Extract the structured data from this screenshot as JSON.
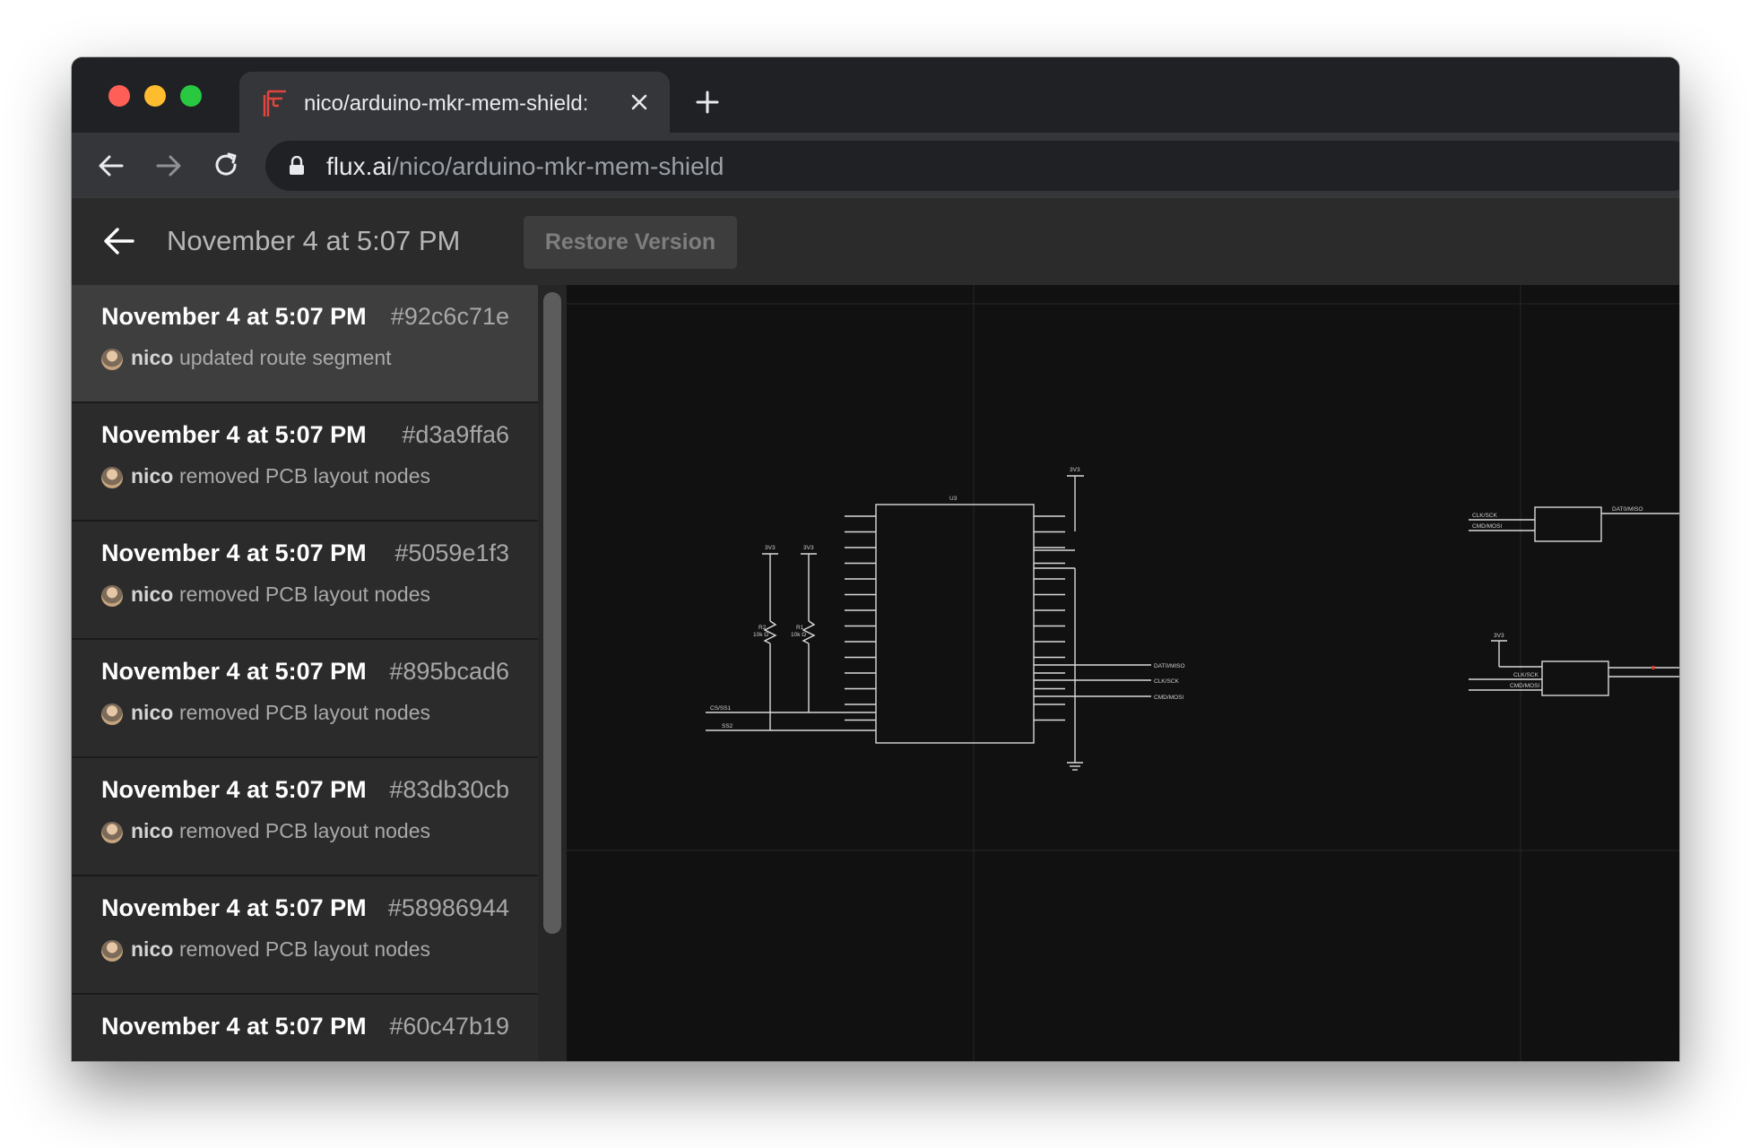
{
  "browser": {
    "tab": {
      "title": "nico/arduino-mkr-mem-shield:"
    },
    "url": {
      "host": "flux.ai",
      "path": "/nico/arduino-mkr-mem-shield"
    }
  },
  "header": {
    "title": "November 4 at 5:07 PM",
    "restore_label": "Restore Version"
  },
  "versions": [
    {
      "date": "November 4 at 5:07 PM",
      "hash": "#92c6c71e",
      "user": "nico",
      "action": "updated route segment",
      "selected": true
    },
    {
      "date": "November 4 at 5:07 PM",
      "hash": "#d3a9ffa6",
      "user": "nico",
      "action": "removed PCB layout nodes"
    },
    {
      "date": "November 4 at 5:07 PM",
      "hash": "#5059e1f3",
      "user": "nico",
      "action": "removed PCB layout nodes"
    },
    {
      "date": "November 4 at 5:07 PM",
      "hash": "#895bcad6",
      "user": "nico",
      "action": "removed PCB layout nodes"
    },
    {
      "date": "November 4 at 5:07 PM",
      "hash": "#83db30cb",
      "user": "nico",
      "action": "removed PCB layout nodes"
    },
    {
      "date": "November 4 at 5:07 PM",
      "hash": "#58986944",
      "user": "nico",
      "action": "removed PCB layout nodes"
    },
    {
      "date": "November 4 at 5:07 PM",
      "hash": "#60c47b19",
      "user": "",
      "action": ""
    }
  ],
  "schematic": {
    "u3_label": "U3",
    "supply_3v3": "3V3",
    "r2_label": "R2",
    "r2_value": "10k Ω",
    "r1_label": "R1",
    "r1_value": "10k Ω",
    "net_cs": "CS/SS1",
    "net_ss2": "SS2",
    "net_dat0": "DAT0/MISO",
    "net_clk": "CLK/SCK",
    "net_cmd": "CMD/MOSI"
  },
  "colors": {
    "tab_favicon": "#e0463c",
    "canvas_bg": "#111111",
    "wire": "#d9d9d9",
    "grid": "#262626"
  },
  "icons": [
    "flux-logo-icon",
    "close-icon",
    "plus-icon",
    "back-arrow-icon",
    "forward-arrow-icon",
    "reload-icon",
    "lock-icon",
    "arrow-left-icon"
  ]
}
